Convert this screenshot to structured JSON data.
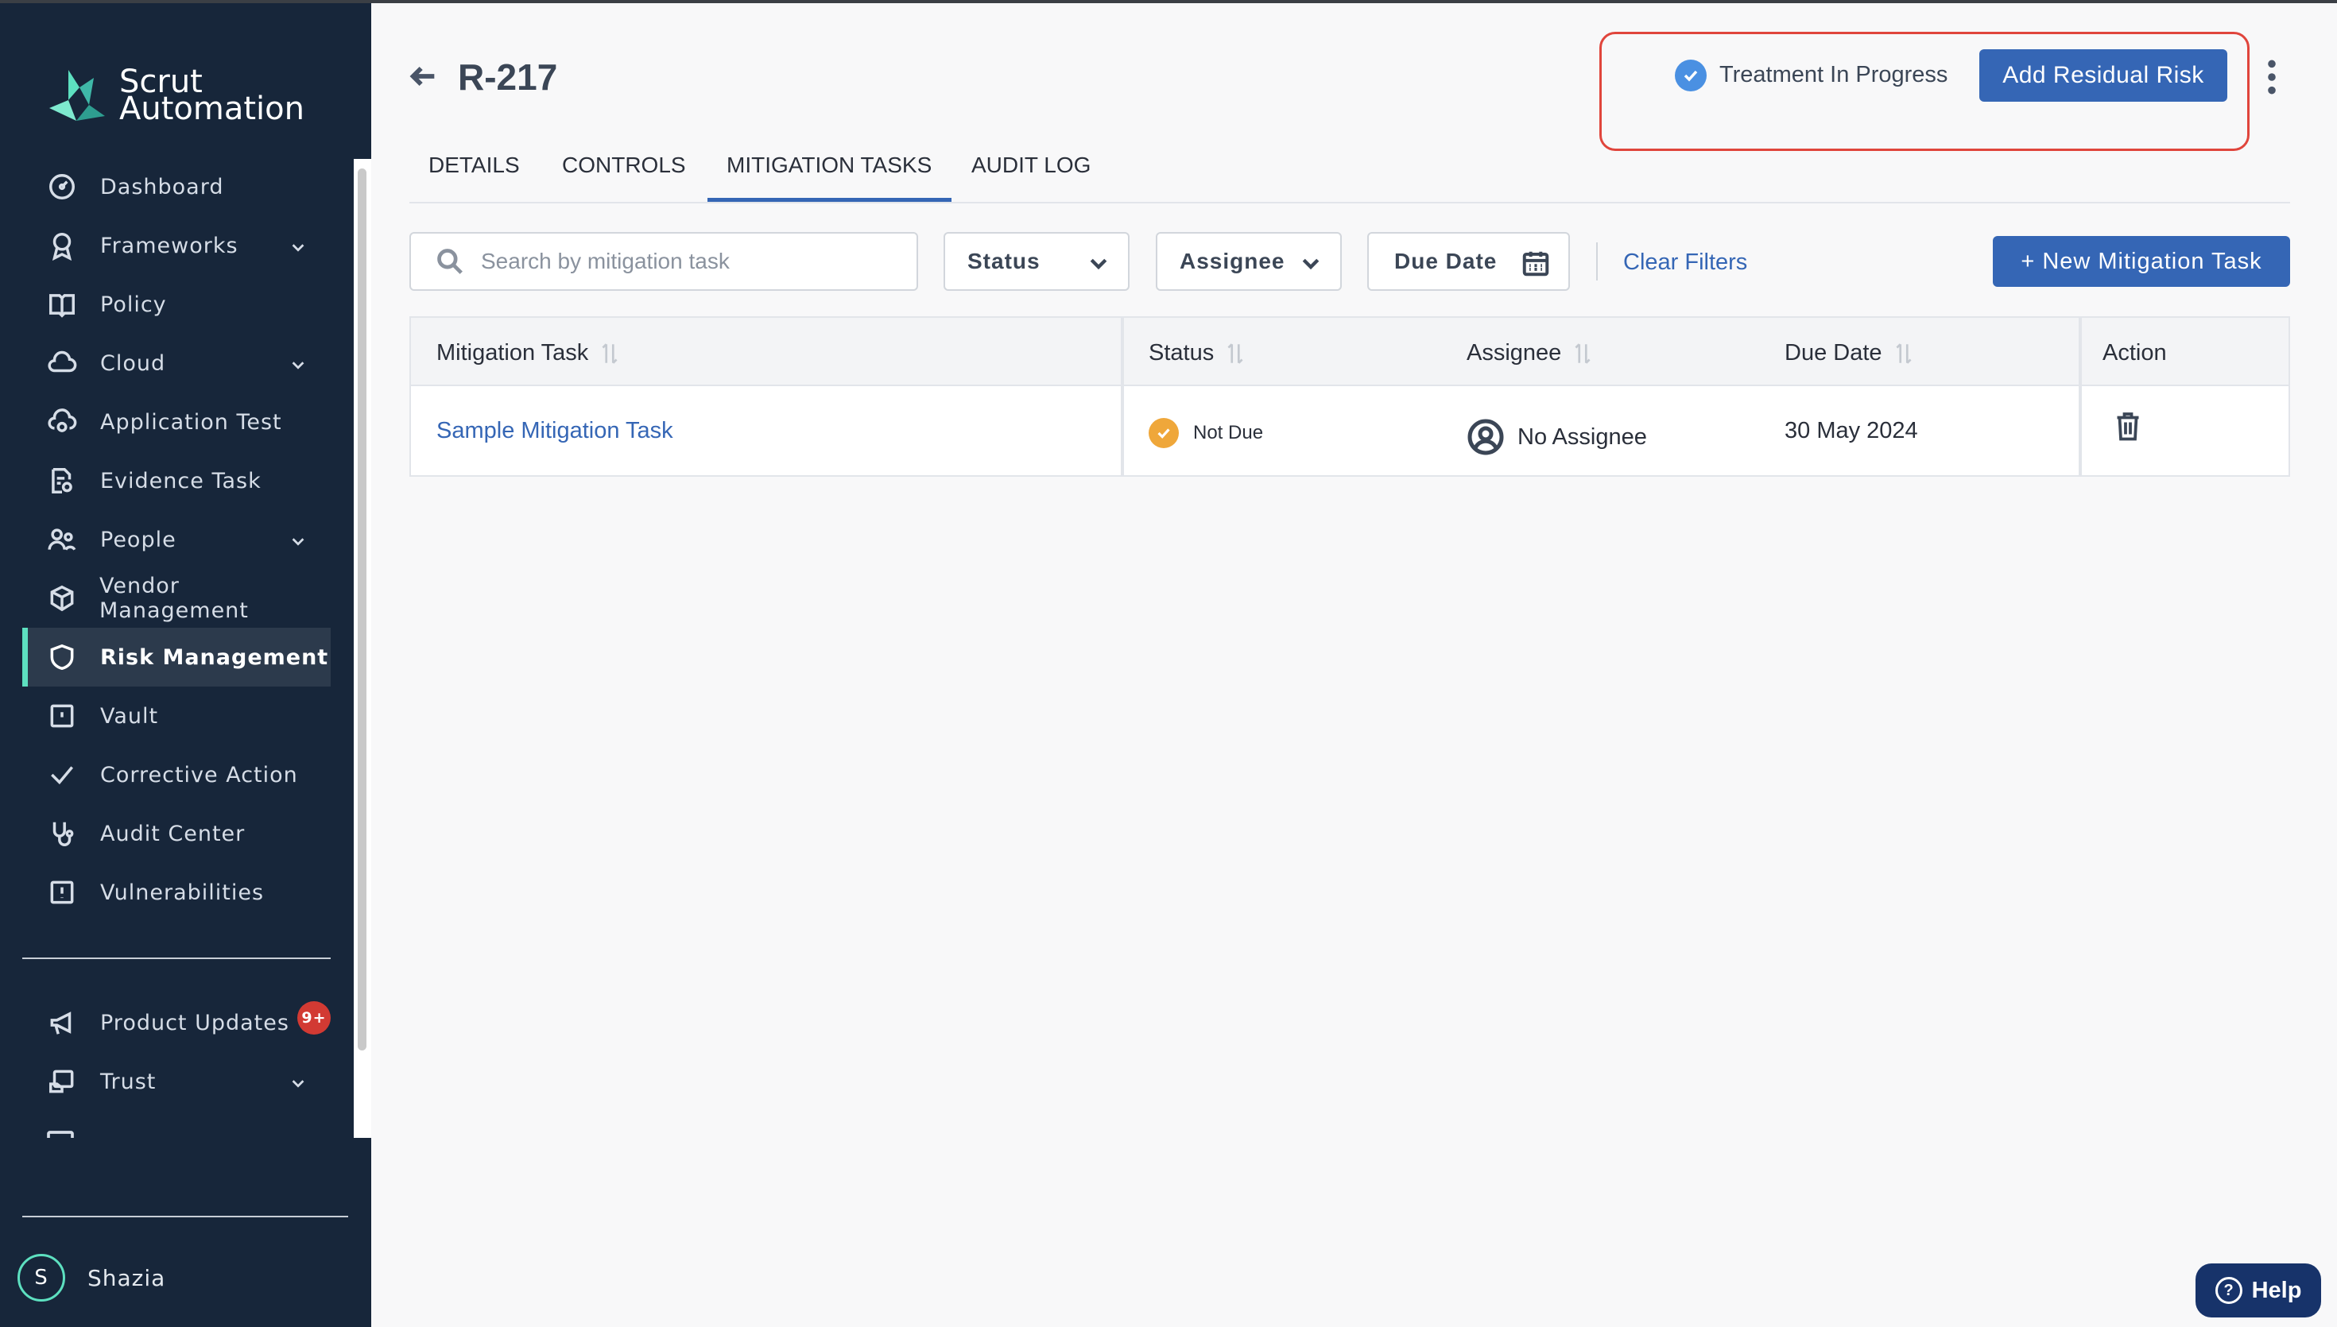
{
  "brand": {
    "line1": "Scrut",
    "line2": "Automation",
    "accent": "#5de0c0"
  },
  "sidebar": {
    "items": [
      {
        "label": "Dashboard",
        "icon": "dashboard-gauge-icon",
        "chevron": false
      },
      {
        "label": "Frameworks",
        "icon": "frameworks-ribbon-icon",
        "chevron": true
      },
      {
        "label": "Policy",
        "icon": "policy-book-icon",
        "chevron": false
      },
      {
        "label": "Cloud",
        "icon": "cloud-icon",
        "chevron": true
      },
      {
        "label": "Application Test",
        "icon": "application-test-icon",
        "chevron": false
      },
      {
        "label": "Evidence Task",
        "icon": "evidence-document-icon",
        "chevron": false
      },
      {
        "label": "People",
        "icon": "people-icon",
        "chevron": true
      },
      {
        "label": "Vendor Management",
        "icon": "vendor-cube-icon",
        "chevron": false
      },
      {
        "label": "Risk Management",
        "icon": "shield-icon",
        "chevron": false,
        "active": true
      },
      {
        "label": "Vault",
        "icon": "vault-icon",
        "chevron": false
      },
      {
        "label": "Corrective Action",
        "icon": "checkmark-icon",
        "chevron": false
      },
      {
        "label": "Audit Center",
        "icon": "stethoscope-icon",
        "chevron": false
      },
      {
        "label": "Vulnerabilities",
        "icon": "alert-square-icon",
        "chevron": false
      }
    ],
    "secondary": [
      {
        "label": "Product Updates",
        "icon": "megaphone-icon",
        "badge": "9+"
      },
      {
        "label": "Trust",
        "icon": "trust-icon",
        "chevron": true
      }
    ],
    "user": {
      "initial": "S",
      "name": "Shazia"
    }
  },
  "header": {
    "title": "R-217",
    "status": "Treatment In Progress",
    "primary_action": "Add Residual Risk"
  },
  "tabs": [
    {
      "label": "DETAILS"
    },
    {
      "label": "CONTROLS"
    },
    {
      "label": "MITIGATION TASKS",
      "active": true
    },
    {
      "label": "AUDIT LOG"
    }
  ],
  "filters": {
    "search_placeholder": "Search by mitigation task",
    "status": "Status",
    "assignee": "Assignee",
    "due_date": "Due Date",
    "clear": "Clear Filters",
    "new_task": "+ New Mitigation Task"
  },
  "table": {
    "columns": [
      "Mitigation Task",
      "Status",
      "Assignee",
      "Due Date",
      "Action"
    ],
    "rows": [
      {
        "task": "Sample Mitigation Task",
        "status": "Not Due",
        "assignee": "No Assignee",
        "due": "30 May 2024"
      }
    ]
  },
  "help": {
    "label": "Help"
  },
  "colors": {
    "primary": "#3566b5",
    "sidebar_bg": "#17263a",
    "status_pending": "#efa73a",
    "highlight": "#e0453c"
  }
}
